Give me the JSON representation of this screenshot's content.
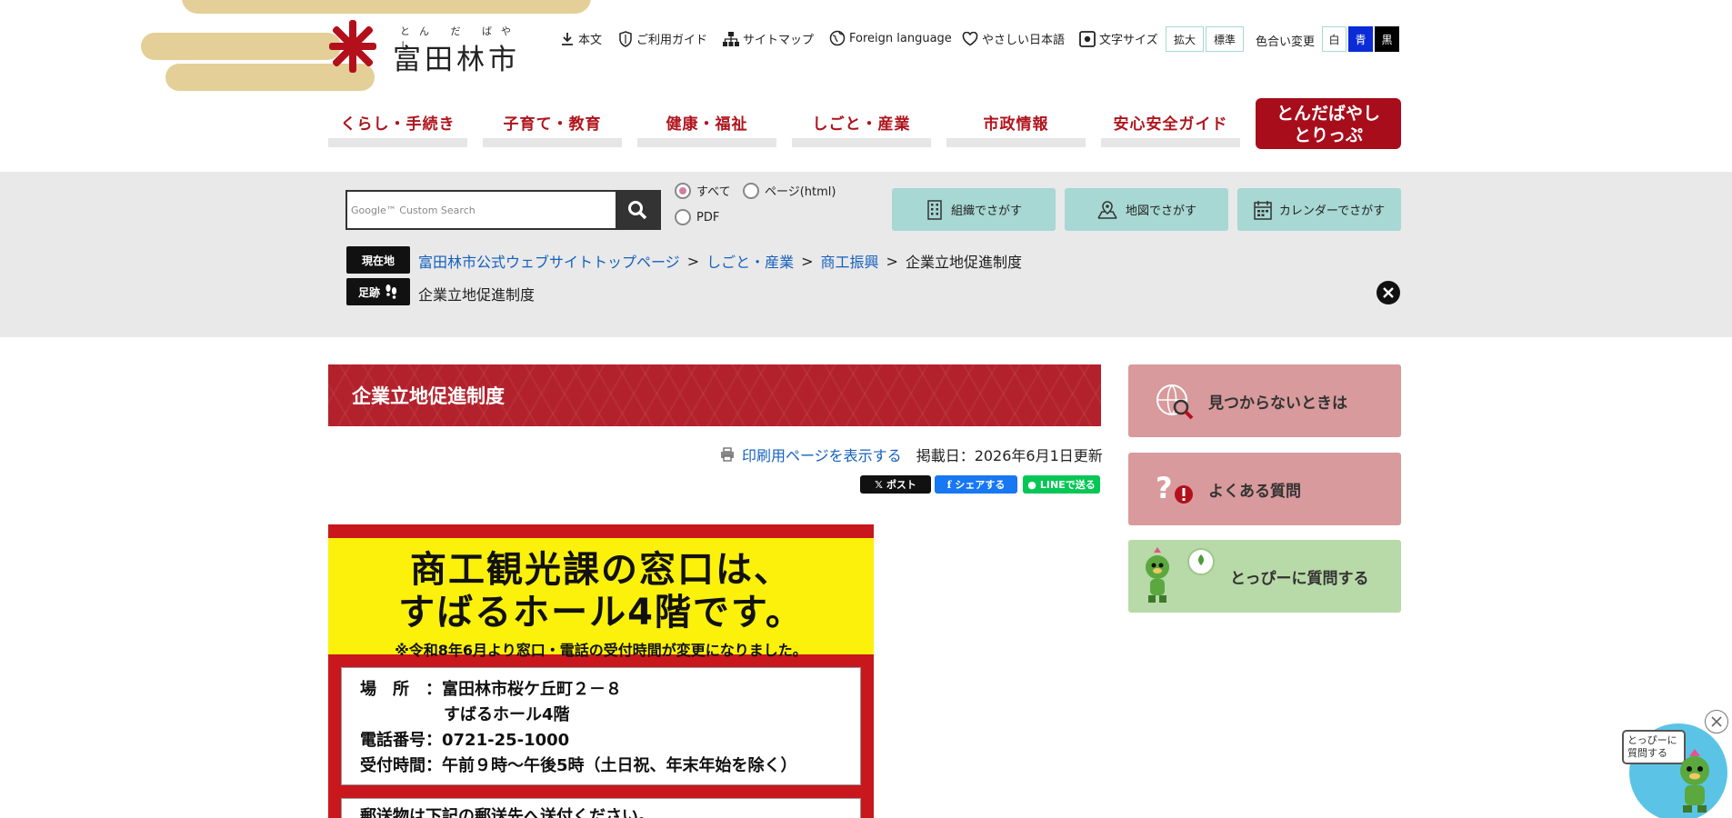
{
  "header": {
    "logo_ruby": "とん だ ばやし",
    "logo_name": "富田林市",
    "util": {
      "skip": "本文",
      "guide": "ご利用ガイド",
      "sitemap": "サイトマップ",
      "foreign": "Foreign language",
      "easy_japanese": "やさしい日本語",
      "text_size": "文字サイズ",
      "size_large": "拡大",
      "size_normal": "標準",
      "color_change": "色合い変更",
      "color_white": "白",
      "color_blue": "青",
      "color_black": "黒"
    },
    "colors": {
      "brand_red": "#b0141d",
      "accent_teal": "#a7d8d3",
      "blue": "#0a2bd6"
    }
  },
  "nav": {
    "items": [
      "くらし・手続き",
      "子育て・教育",
      "健康・福祉",
      "しごと・産業",
      "市政情報",
      "安心安全ガイド"
    ],
    "special_line1": "とんだばやし",
    "special_line2": "とりっぷ"
  },
  "search": {
    "placeholder": "Google™ Custom Search",
    "radio_all": "すべて",
    "radio_html": "ページ(html)",
    "radio_pdf": "PDF",
    "find_org": "組織でさがす",
    "find_map": "地図でさがす",
    "find_calendar": "カレンダーでさがす"
  },
  "breadcrumb": {
    "current_tag": "現在地",
    "items": [
      "富田林市公式ウェブサイトトップページ",
      "しごと・産業",
      "商工振興"
    ],
    "current": "企業立地促進制度",
    "history_tag": "足跡",
    "history_item": "企業立地促進制度"
  },
  "page": {
    "title": "企業立地促進制度",
    "print_link": "印刷用ページを表示する",
    "date": "掲載日：2026年6月1日更新",
    "sns_x": "ポスト",
    "sns_fb": "シェアする",
    "sns_line": "LINEで送る"
  },
  "notice": {
    "line1": "商工観光課の窓口は、",
    "line2": "すばるホール4階です。",
    "sub": "※令和8年6月より窓口・電話の受付時間が変更になりました。",
    "place": "場　所　：富田林市桜ケ丘町２－８",
    "place2": "すばるホール4階",
    "phone": "電話番号：0721-25-1000",
    "hours": "受付時間：午前９時～午後5時（土日祝、年末年始を除く）",
    "mail": "郵送物は下記の郵送先へ送付ください。"
  },
  "side": {
    "not_found": "見つからないときは",
    "faq": "よくある質問",
    "ask_tonpy": "とっぴーに質問する"
  },
  "floating": {
    "bubble_line1": "とっぴーに",
    "bubble_line2": "質問する"
  }
}
